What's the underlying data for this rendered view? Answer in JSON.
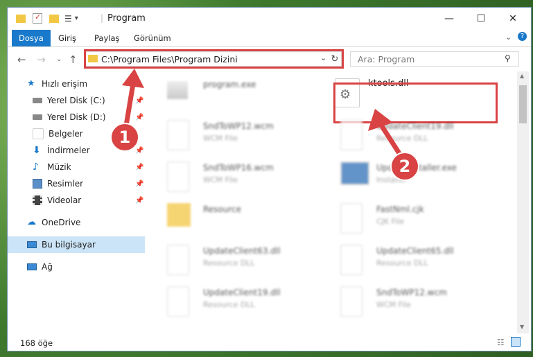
{
  "window": {
    "title": "Program"
  },
  "ribbon": {
    "tabs": [
      "Dosya",
      "Giriş",
      "Paylaş",
      "Görünüm"
    ]
  },
  "nav": {
    "address": "C:\\Program Files\\Program Dizini",
    "search_placeholder": "Ara: Program"
  },
  "sidebar": {
    "items": [
      {
        "label": "Hızlı erişim"
      },
      {
        "label": "Yerel Disk (C:)"
      },
      {
        "label": "Yerel Disk (D:)"
      },
      {
        "label": "Belgeler"
      },
      {
        "label": "İndirmeler"
      },
      {
        "label": "Müzik"
      },
      {
        "label": "Resimler"
      },
      {
        "label": "Videolar"
      },
      {
        "label": "OneDrive"
      },
      {
        "label": "Bu bilgisayar"
      },
      {
        "label": "Ağ"
      }
    ]
  },
  "files": [
    {
      "name": "program.exe",
      "type": ""
    },
    {
      "name": "ktools.dll",
      "type": ""
    },
    {
      "name": "SndToWP12.wcm",
      "type": "WCM File"
    },
    {
      "name": "UpdateClient19.dll",
      "type": "Resource DLL"
    },
    {
      "name": "SndToWP16.wcm",
      "type": "WCM File"
    },
    {
      "name": "UpdateInstaller.exe",
      "type": "Installer"
    },
    {
      "name": "Resource",
      "type": ""
    },
    {
      "name": "FastNml.cjk",
      "type": "CJK File"
    },
    {
      "name": "UpdateClient63.dll",
      "type": "Resource DLL"
    },
    {
      "name": "UpdateClient65.dll",
      "type": "Resource DLL"
    },
    {
      "name": "UpdateClient19.dll",
      "type": "Resource DLL"
    },
    {
      "name": "SndToWP12.wcm",
      "type": "WCM File"
    }
  ],
  "status": {
    "count": "168 öğe"
  },
  "annotations": {
    "one": "1",
    "two": "2"
  },
  "colors": {
    "accent": "#1979ca",
    "highlight": "#d94343",
    "selected": "#cce4f7"
  }
}
